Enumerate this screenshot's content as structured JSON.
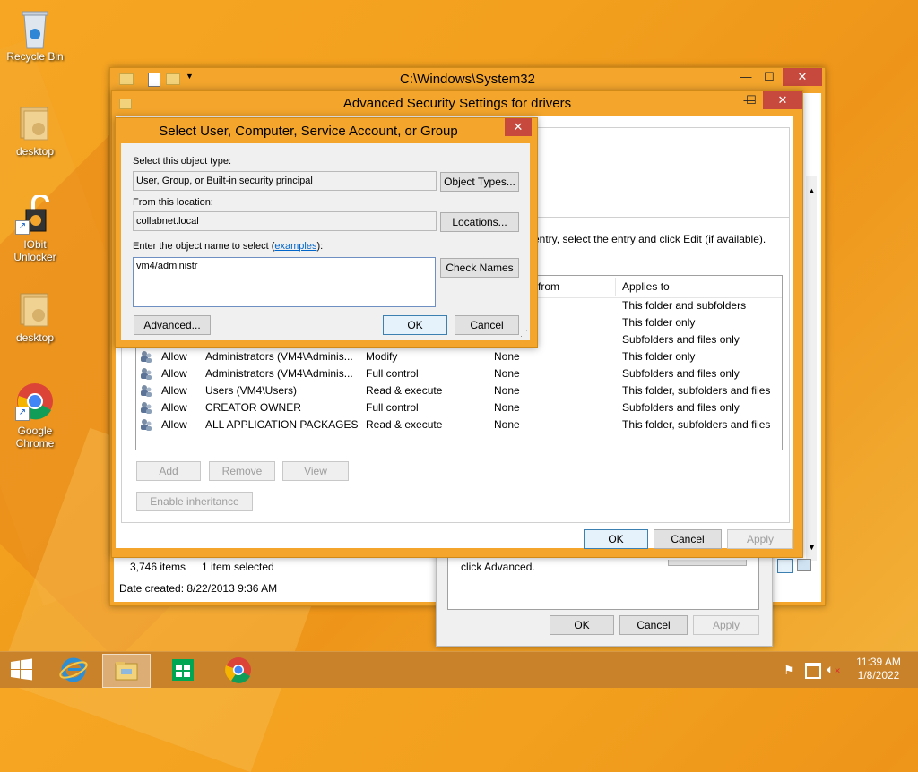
{
  "desktop": {
    "icons": [
      {
        "label": "Recycle Bin"
      },
      {
        "label": "desktop"
      },
      {
        "label": "IObit Unlocker"
      },
      {
        "label": "desktop"
      },
      {
        "label": "Google Chrome"
      }
    ]
  },
  "explorer": {
    "title": "C:\\Windows\\System32",
    "status_items": "3,746 items",
    "status_selected": "1 item selected",
    "date_created": "Date created: 8/22/2013 9:36 AM"
  },
  "props_dialog": {
    "text": "click Advanced.",
    "ok": "OK",
    "cancel": "Cancel",
    "apply": "Apply"
  },
  "adv": {
    "title": "Advanced Security Settings for drivers",
    "instruction": "entry, select the entry and click Edit (if available).",
    "col_from": "from",
    "col_applies": "Applies to",
    "rows": [
      {
        "type": "",
        "principal": "",
        "access": "",
        "inherited": "",
        "applies": "This folder and subfolders"
      },
      {
        "type": "",
        "principal": "",
        "access": "",
        "inherited": "",
        "applies": "This folder only"
      },
      {
        "type": "",
        "principal": "",
        "access": "",
        "inherited": "",
        "applies": "Subfolders and files only"
      },
      {
        "type": "Allow",
        "principal": "Administrators (VM4\\Adminis...",
        "access": "Modify",
        "inherited": "None",
        "applies": "This folder only"
      },
      {
        "type": "Allow",
        "principal": "Administrators (VM4\\Adminis...",
        "access": "Full control",
        "inherited": "None",
        "applies": "Subfolders and files only"
      },
      {
        "type": "Allow",
        "principal": "Users (VM4\\Users)",
        "access": "Read & execute",
        "inherited": "None",
        "applies": "This folder, subfolders and files"
      },
      {
        "type": "Allow",
        "principal": "CREATOR OWNER",
        "access": "Full control",
        "inherited": "None",
        "applies": "Subfolders and files only"
      },
      {
        "type": "Allow",
        "principal": "ALL APPLICATION PACKAGES",
        "access": "Read & execute",
        "inherited": "None",
        "applies": "This folder, subfolders and files"
      }
    ],
    "add": "Add",
    "remove": "Remove",
    "view": "View",
    "enable_inheritance": "Enable inheritance",
    "ok": "OK",
    "cancel": "Cancel",
    "apply": "Apply"
  },
  "select": {
    "title": "Select User, Computer, Service Account, or Group",
    "object_type_label": "Select this object type:",
    "object_type_value": "User, Group, or Built-in security principal",
    "object_types_btn": "Object Types...",
    "location_label": "From this location:",
    "location_value": "collabnet.local",
    "locations_btn": "Locations...",
    "name_label": "Enter the object name to select (",
    "examples_link": "examples",
    "name_label_end": "):",
    "name_value": "vm4/administr",
    "check_names_btn": "Check Names",
    "advanced_btn": "Advanced...",
    "ok": "OK",
    "cancel": "Cancel"
  },
  "taskbar": {
    "time": "11:39 AM",
    "date": "1/8/2022"
  }
}
